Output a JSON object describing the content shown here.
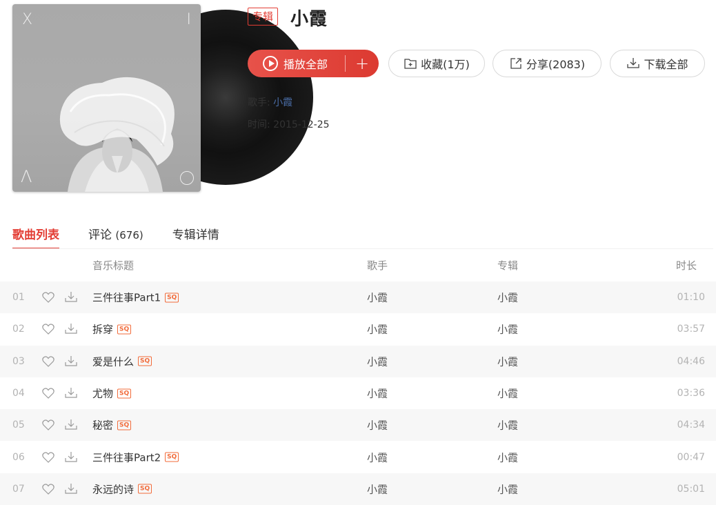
{
  "album": {
    "tag": "专辑",
    "title": "小霞",
    "cover": {
      "corners": [
        "X",
        "I",
        "Λ",
        "O"
      ]
    },
    "singer_label": "歌手:",
    "singer": "小霞",
    "date_label": "时间:",
    "date": "2015-12-25"
  },
  "actions": {
    "play_all": "播放全部",
    "add": "+",
    "collect": "收藏(1万)",
    "share": "分享(2083)",
    "download_all": "下载全部"
  },
  "tabs": [
    {
      "label": "歌曲列表",
      "count": "",
      "active": true
    },
    {
      "label": "评论",
      "count": "(676)",
      "active": false
    },
    {
      "label": "专辑详情",
      "count": "",
      "active": false
    }
  ],
  "columns": {
    "title": "音乐标题",
    "artist": "歌手",
    "album": "专辑",
    "duration": "时长"
  },
  "songs": [
    {
      "num": "01",
      "title": "三件往事Part1",
      "quality": "SQ",
      "artist": "小霞",
      "album": "小霞",
      "duration": "01:10"
    },
    {
      "num": "02",
      "title": "拆穿",
      "quality": "SQ",
      "artist": "小霞",
      "album": "小霞",
      "duration": "03:57"
    },
    {
      "num": "03",
      "title": "爱是什么",
      "quality": "SQ",
      "artist": "小霞",
      "album": "小霞",
      "duration": "04:46"
    },
    {
      "num": "04",
      "title": "尤物",
      "quality": "SQ",
      "artist": "小霞",
      "album": "小霞",
      "duration": "03:36"
    },
    {
      "num": "05",
      "title": "秘密",
      "quality": "SQ",
      "artist": "小霞",
      "album": "小霞",
      "duration": "04:34"
    },
    {
      "num": "06",
      "title": "三件往事Part2",
      "quality": "SQ",
      "artist": "小霞",
      "album": "小霞",
      "duration": "00:47"
    },
    {
      "num": "07",
      "title": "永远的诗",
      "quality": "SQ",
      "artist": "小霞",
      "album": "小霞",
      "duration": "05:01"
    }
  ],
  "icons": {
    "play": "play-circle-icon",
    "collect": "folder-plus-icon",
    "share": "share-arrow-icon",
    "download": "download-icon",
    "like": "heart-icon"
  },
  "colors": {
    "accent": "#e33d34",
    "link": "#4a6da7",
    "quality_badge": "#f26b3a"
  }
}
